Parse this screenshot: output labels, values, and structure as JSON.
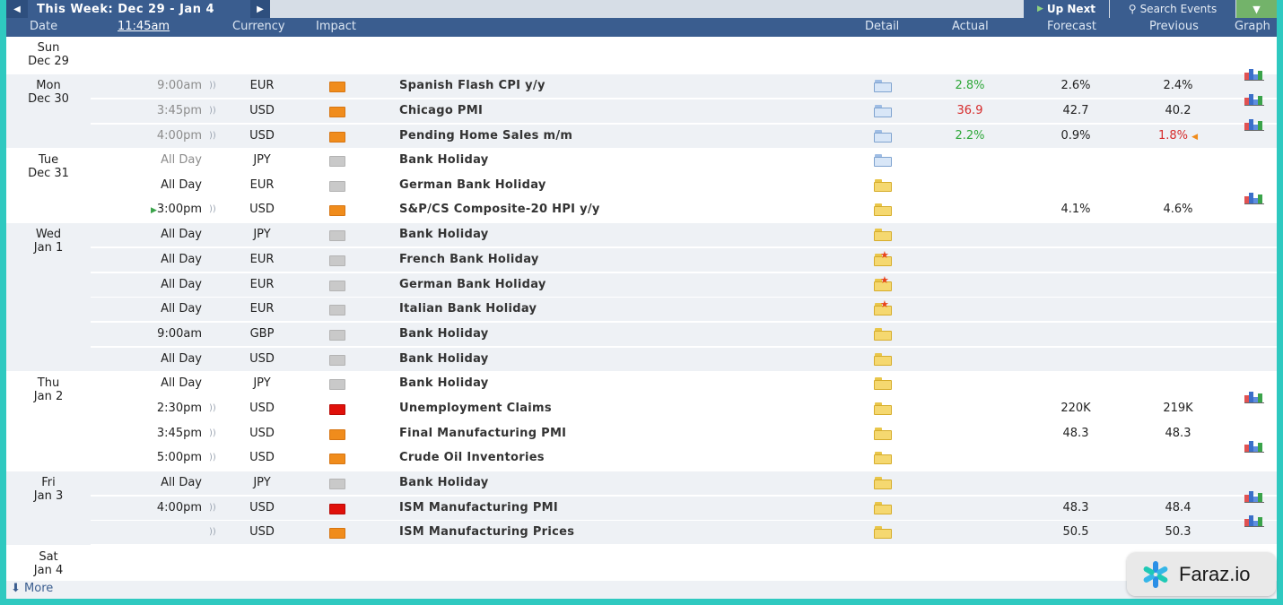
{
  "toolbar": {
    "week_title": "This Week: Dec 29 - Jan 4",
    "up_next": "Up Next",
    "search_events": "Search Events"
  },
  "header": {
    "date": "Date",
    "time": "11:45am",
    "currency": "Currency",
    "impact": "Impact",
    "detail": "Detail",
    "actual": "Actual",
    "forecast": "Forecast",
    "previous": "Previous",
    "graph": "Graph"
  },
  "days": [
    {
      "day": "Sun",
      "date": "Dec 29"
    },
    {
      "day": "Mon",
      "date": "Dec 30"
    },
    {
      "day": "Tue",
      "date": "Dec 31"
    },
    {
      "day": "Wed",
      "date": "Jan 1"
    },
    {
      "day": "Thu",
      "date": "Jan 2"
    },
    {
      "day": "Fri",
      "date": "Jan 3"
    },
    {
      "day": "Sat",
      "date": "Jan 4"
    }
  ],
  "events": [
    {
      "time": "9:00am",
      "currency": "EUR",
      "event": "Spanish Flash CPI y/y",
      "actual": "2.8%",
      "forecast": "2.6%",
      "previous": "2.4%"
    },
    {
      "time": "3:45pm",
      "currency": "USD",
      "event": "Chicago PMI",
      "actual": "36.9",
      "forecast": "42.7",
      "previous": "40.2"
    },
    {
      "time": "4:00pm",
      "currency": "USD",
      "event": "Pending Home Sales m/m",
      "actual": "2.2%",
      "forecast": "0.9%",
      "previous": "1.8%"
    },
    {
      "time": "All Day",
      "currency": "JPY",
      "event": "Bank Holiday",
      "actual": "",
      "forecast": "",
      "previous": ""
    },
    {
      "time": "All Day",
      "currency": "EUR",
      "event": "German Bank Holiday",
      "actual": "",
      "forecast": "",
      "previous": ""
    },
    {
      "time": "3:00pm",
      "currency": "USD",
      "event": "S&P/CS Composite-20 HPI y/y",
      "actual": "",
      "forecast": "4.1%",
      "previous": "4.6%"
    },
    {
      "time": "All Day",
      "currency": "JPY",
      "event": "Bank Holiday",
      "actual": "",
      "forecast": "",
      "previous": ""
    },
    {
      "time": "All Day",
      "currency": "EUR",
      "event": "French Bank Holiday",
      "actual": "",
      "forecast": "",
      "previous": ""
    },
    {
      "time": "All Day",
      "currency": "EUR",
      "event": "German Bank Holiday",
      "actual": "",
      "forecast": "",
      "previous": ""
    },
    {
      "time": "All Day",
      "currency": "EUR",
      "event": "Italian Bank Holiday",
      "actual": "",
      "forecast": "",
      "previous": ""
    },
    {
      "time": "9:00am",
      "currency": "GBP",
      "event": "Bank Holiday",
      "actual": "",
      "forecast": "",
      "previous": ""
    },
    {
      "time": "All Day",
      "currency": "USD",
      "event": "Bank Holiday",
      "actual": "",
      "forecast": "",
      "previous": ""
    },
    {
      "time": "All Day",
      "currency": "JPY",
      "event": "Bank Holiday",
      "actual": "",
      "forecast": "",
      "previous": ""
    },
    {
      "time": "2:30pm",
      "currency": "USD",
      "event": "Unemployment Claims",
      "actual": "",
      "forecast": "220K",
      "previous": "219K"
    },
    {
      "time": "3:45pm",
      "currency": "USD",
      "event": "Final Manufacturing PMI",
      "actual": "",
      "forecast": "48.3",
      "previous": "48.3"
    },
    {
      "time": "5:00pm",
      "currency": "USD",
      "event": "Crude Oil Inventories",
      "actual": "",
      "forecast": "",
      "previous": ""
    },
    {
      "time": "All Day",
      "currency": "JPY",
      "event": "Bank Holiday",
      "actual": "",
      "forecast": "",
      "previous": ""
    },
    {
      "time": "4:00pm",
      "currency": "USD",
      "event": "ISM Manufacturing PMI",
      "actual": "",
      "forecast": "48.3",
      "previous": "48.4"
    },
    {
      "time": "",
      "currency": "USD",
      "event": "ISM Manufacturing Prices",
      "actual": "",
      "forecast": "50.5",
      "previous": "50.3"
    }
  ],
  "footer": {
    "more": "More"
  },
  "watermark": {
    "text": "Faraz.io"
  },
  "colors": {
    "header_bg": "#3a5d8f",
    "impact_high": "#e0100a",
    "impact_medium": "#f08c1c",
    "impact_low": "#c9c9c9",
    "actual_better": "#2fa83a",
    "actual_worse": "#d62b2b"
  }
}
